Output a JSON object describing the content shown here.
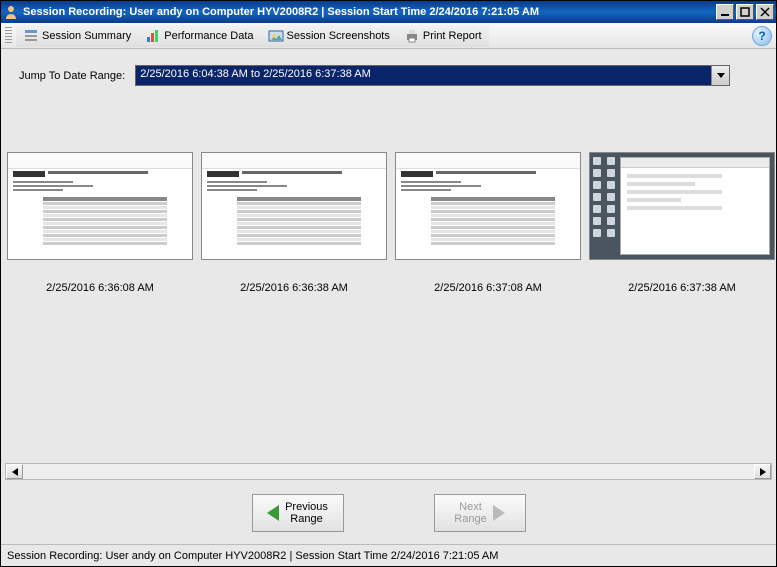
{
  "window": {
    "title": "Session Recording: User andy on Computer HYV2008R2 | Session Start Time 2/24/2016 7:21:05 AM"
  },
  "toolbar": {
    "session_summary": "Session Summary",
    "performance_data": "Performance Data",
    "session_screenshots": "Session Screenshots",
    "print_report": "Print Report"
  },
  "jump_label": "Jump To Date Range:",
  "date_range_selected": "2/25/2016 6:04:38 AM to 2/25/2016 6:37:38 AM",
  "thumbnails": [
    {
      "caption": "2/25/2016 6:36:08 AM",
      "kind": "report"
    },
    {
      "caption": "2/25/2016 6:36:38 AM",
      "kind": "report"
    },
    {
      "caption": "2/25/2016 6:37:08 AM",
      "kind": "report"
    },
    {
      "caption": "2/25/2016 6:37:38 AM",
      "kind": "desktop"
    }
  ],
  "nav": {
    "prev": "Previous\nRange",
    "next": "Next\nRange"
  },
  "statusbar": "Session Recording: User andy on Computer HYV2008R2 | Session Start Time 2/24/2016 7:21:05 AM"
}
